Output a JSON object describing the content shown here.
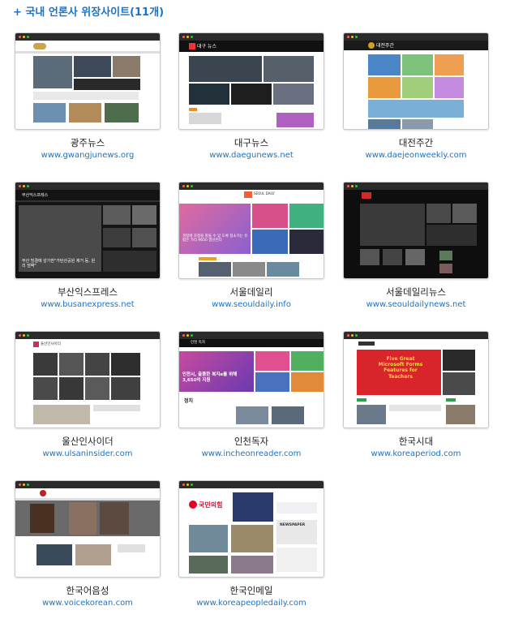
{
  "heading": "+ 국내 언론사 위장사이트(11개)",
  "sites": [
    {
      "name": "광주뉴스",
      "url": "www.gwangjunews.org"
    },
    {
      "name": "대구뉴스",
      "url": "www.daegunews.net"
    },
    {
      "name": "대전주간",
      "url": "www.daejeonweekly.com"
    },
    {
      "name": "부산익스프레스",
      "url": "www.busanexpress.net"
    },
    {
      "name": "서울데일리",
      "url": "www.seouldaily.info"
    },
    {
      "name": "서울데일리뉴스",
      "url": "www.seouldailynews.net"
    },
    {
      "name": "울산인사이더",
      "url": "www.ulsaninsider.com"
    },
    {
      "name": "인천독자",
      "url": "www.incheonreader.com"
    },
    {
      "name": "한국시대",
      "url": "www.koreaperiod.com"
    },
    {
      "name": "한국어음성",
      "url": "www.voicekorean.com"
    },
    {
      "name": "한국인메일",
      "url": "www.koreapeopledaily.com"
    }
  ],
  "thumb_text": {
    "daegu_logo": "대구 뉴스",
    "daejeon_logo": "대전주간",
    "busan_logo": "부산익스프레스",
    "busan_headline": "부산 빙결에 감가한\"가탄산공원 제거 등, 원리 엄벽\"",
    "seoul_logo": "SEOUL DAILY",
    "seoul_headline": "경찰에 조정을 맡을 수 있 도록 정소기는 유럽은 가리 9650 결산된다",
    "ulsan_logo": "울산인사이더",
    "incheon_logo": "인천 독자",
    "incheon_headline": "인천시, 출품한 복지e를 위해 3,650억 지원",
    "incheon_section": "정치",
    "korea_period_headline": "Five Great Microsoft Forms Features for Teachers",
    "ppp_logo": "국민의힘",
    "newspaper": "NEWSPAPER"
  },
  "colors": {
    "accent": "#1a73c8",
    "ppp_red": "#e4002b"
  }
}
